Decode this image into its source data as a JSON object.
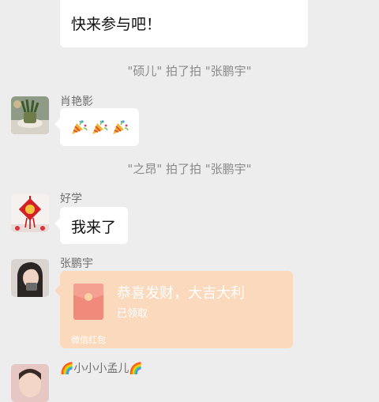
{
  "colors": {
    "background": "#ededed",
    "bubble": "#ffffff",
    "red_packet_bg": "#fbd9bd",
    "red_packet_text": "#ffffff",
    "system_text": "#8a8a8a"
  },
  "messages": {
    "top": {
      "text": "快来参与吧！"
    },
    "sys1": {
      "text": "\"硕儿\" 拍了拍 \"张鹏宇\""
    },
    "msg_xiao": {
      "sender": "肖艳影",
      "emojis": [
        "party-popper",
        "party-popper",
        "party-popper"
      ]
    },
    "sys2": {
      "text": "\"之昂\" 拍了拍 \"张鹏宇\""
    },
    "msg_hao": {
      "sender": "好学",
      "text": "我来了"
    },
    "msg_zhang": {
      "sender": "张鹏宇",
      "red_packet": {
        "title": "恭喜发财，大吉大利",
        "status": "已领取",
        "footer": "微信红包"
      }
    },
    "msg_meng": {
      "sender": "🌈小小小孟儿🌈"
    }
  }
}
